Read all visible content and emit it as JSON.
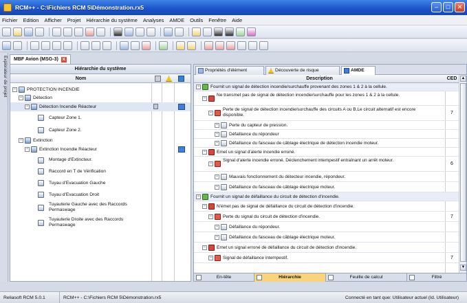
{
  "window": {
    "title": "RCM++ - C:\\Fichiers RCM 5\\Démonstration.rx5"
  },
  "menu": [
    "Fichier",
    "Edition",
    "Afficher",
    "Projet",
    "Hiérarchie du système",
    "Analyses",
    "AMDE",
    "Outils",
    "Fenêtre",
    "Aide"
  ],
  "side_panel": {
    "label": "Explorateur de projet"
  },
  "document_tab": {
    "label": "MBF Avion (MSG-3)"
  },
  "hierarchy": {
    "title": "Hiérarchie du système",
    "column_name": "Nom",
    "items": [
      {
        "label": "PROTECTION INCENDIE"
      },
      {
        "label": "Détection"
      },
      {
        "label": "Détection Incendie Réacteur"
      },
      {
        "label": "Capteur Zone 1."
      },
      {
        "label": "Capteur Zone 2."
      },
      {
        "label": "Extinction"
      },
      {
        "label": "Extinction Incendie Réacteur"
      },
      {
        "label": "Montage d'Extincteur."
      },
      {
        "label": "Raccord en T de Vérification"
      },
      {
        "label": "Tuyau d'Evacuation Gauche"
      },
      {
        "label": "Tuyau d'Evacuation Droit"
      },
      {
        "label": "Tuyauterie Gauche avec des Raccords Permaswage"
      },
      {
        "label": "Tuyauterie Droite avec des Raccords Permaswage"
      }
    ]
  },
  "right_tabs": [
    "Propriétés d'élément",
    "Découverte de risque",
    "AMDE"
  ],
  "amde": {
    "col_description": "Description",
    "col_ced": "CED",
    "rows": [
      {
        "text": "Fournit un signal de détection incendie/surchauffe provenant des zones 1 & 2 à la cellule.",
        "ced": ""
      },
      {
        "text": "Ne transmet pas de signal de détection incendie/surchauffe pour les zones 1 & 2 à la cellule.",
        "ced": ""
      },
      {
        "text": "Perte de signal de détection incendie/surchauffe des circuits A ou B.Le circuit alternatif est encore disponible.",
        "ced": "7"
      },
      {
        "text": "Perte du capteur de pression.",
        "ced": ""
      },
      {
        "text": "Défaillance du répondeur",
        "ced": ""
      },
      {
        "text": "Défaillance du faisceau de câblage électrique de détection incendie moteur.",
        "ced": ""
      },
      {
        "text": "Emet un signal d'alerte incendie erroné.",
        "ced": ""
      },
      {
        "text": "Signal d'alerte incendie erroné. Déclenchement intempestif entraînant un arrêt moteur.",
        "ced": "6"
      },
      {
        "text": "Mauvais fonctionnement du détecteur incendie, répondeur.",
        "ced": ""
      },
      {
        "text": "Défaillance du faisceau de câblage électrique moteur.",
        "ced": ""
      },
      {
        "text": "Fournit un signal de défaillance du circuit de détection d'incendie.",
        "ced": ""
      },
      {
        "text": "N'émet pas de signal de défaillance du circuit de détection d'incendie.",
        "ced": ""
      },
      {
        "text": "Perte du signal du circuit de détection d'incendie.",
        "ced": "7"
      },
      {
        "text": "Défaillance du répondeur.",
        "ced": ""
      },
      {
        "text": "Défaillance du faisceau de câblage électrique moteur.",
        "ced": ""
      },
      {
        "text": "Emet un signal erroné de défaillance du circuit de détection d'incendie.",
        "ced": ""
      },
      {
        "text": "Signal de défaillance intempestif.",
        "ced": "7"
      }
    ]
  },
  "bottom_tabs": [
    "En-tête",
    "Hiérarchie",
    "Feuille de calcul",
    "Filtré"
  ],
  "status": {
    "version": "Reliasoft RCM 5.0.1",
    "path": "RCM++ - C:\\Fichiers RCM 5\\Démonstration.rx5",
    "user": "Connecté en tant que: Utilisateur actuel (Id. Utilisateur)"
  }
}
